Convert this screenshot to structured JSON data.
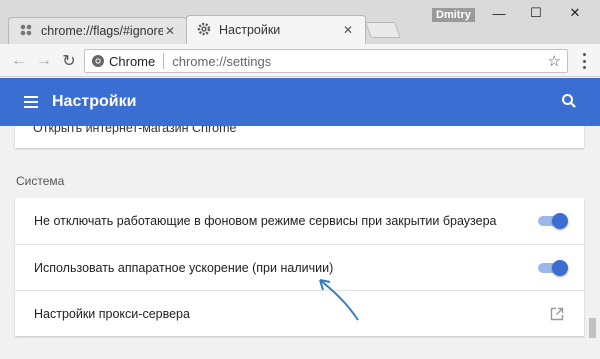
{
  "tabs": [
    {
      "title": "chrome://flags/#ignore-"
    },
    {
      "title": "Настройки"
    }
  ],
  "window": {
    "user": "Dmitry"
  },
  "toolbar": {
    "site_label": "Chrome",
    "url": "chrome://settings"
  },
  "header": {
    "title": "Настройки"
  },
  "settings": {
    "prev_item": "Открыть интернет-магазин Chrome",
    "section_title": "Система",
    "items": [
      {
        "label": "Не отключать работающие в фоновом режиме сервисы при закрытии браузера",
        "type": "toggle",
        "enabled": true
      },
      {
        "label": "Использовать аппаратное ускорение (при наличии)",
        "type": "toggle",
        "enabled": true
      },
      {
        "label": "Настройки прокси-сервера",
        "type": "external-link"
      }
    ]
  },
  "colors": {
    "accent": "#3b6ed2",
    "toggle_track": "#9cb8ea",
    "annotation": "#2f7fc0"
  }
}
